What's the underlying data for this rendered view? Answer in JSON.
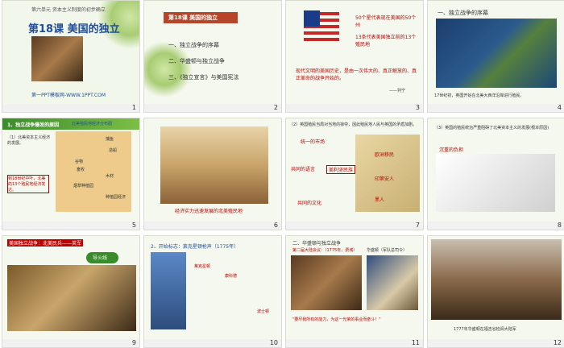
{
  "slides": [
    {
      "num": "1",
      "unit": "第六单元 资本主义制度的初步确立",
      "title": "第18课 美国的独立",
      "footer": "第一PPT模板网-WWW.1PPT.COM"
    },
    {
      "num": "2",
      "header": "第18课 美国的独立",
      "items": [
        "一、独立战争的序幕",
        "二、华盛顿与独立战争",
        "三、《独立宣言》与美国宪法"
      ]
    },
    {
      "num": "3",
      "text1": "50个星代表现在美国的50个州",
      "text2": "13条代表美国独立前的13个殖民地",
      "quote": "现代文明的美国历史，是由一次伟大的、真正解放的、真正革命的战争开始的。",
      "quote_by": "——列宁"
    },
    {
      "num": "4",
      "header": "一、独立战争的序幕",
      "caption": "17世纪初，英国开始在北美大西洋沿岸进行殖民。"
    },
    {
      "num": "5",
      "header": "1、独立战争爆发的原因",
      "map_title": "北美殖民地经济分布图",
      "point": "（1）北美资本主义经济的发展。",
      "labels": [
        "捕鱼",
        "造船",
        "谷物",
        "畜牧",
        "木材",
        "烟草种植园",
        "种植园经济"
      ],
      "note": "到18世纪中叶，北美的13个殖民地经济发达。"
    },
    {
      "num": "6",
      "caption": "经济实力迅速发展的北美殖民地"
    },
    {
      "num": "7",
      "intro": "（2）英国殖民当局对当地的掠夺，因此殖民地人民与英国的矛盾加剧。",
      "labels": [
        "统一的市场",
        "共同的语言",
        "美利坚民族",
        "共同的文化",
        "欧洲移民",
        "印第安人",
        "黑人"
      ]
    },
    {
      "num": "8",
      "point": "（3）英国的殖民统治严重阻碍了北美资本主义的发展(根本原因)",
      "cartoon_title": "沉重的负担"
    },
    {
      "num": "9",
      "text": "美国独立战争：北美民兵——英军",
      "badge": "导火线"
    },
    {
      "num": "10",
      "header": "2、开始标志：莱克星顿枪声（1775年）",
      "labels": [
        "莱克星顿",
        "波士顿",
        "康科德"
      ]
    },
    {
      "num": "11",
      "header": "二、华盛顿与独立战争",
      "sub": "第二届大陆会议：（1775年，费城）",
      "person": "华盛顿（军队总司令）",
      "quote": "\"要尽我所有的能力，为这一光荣的事业而奋斗！\""
    },
    {
      "num": "12",
      "caption": "1777年华盛顿在福吉谷检阅大陆军"
    }
  ]
}
